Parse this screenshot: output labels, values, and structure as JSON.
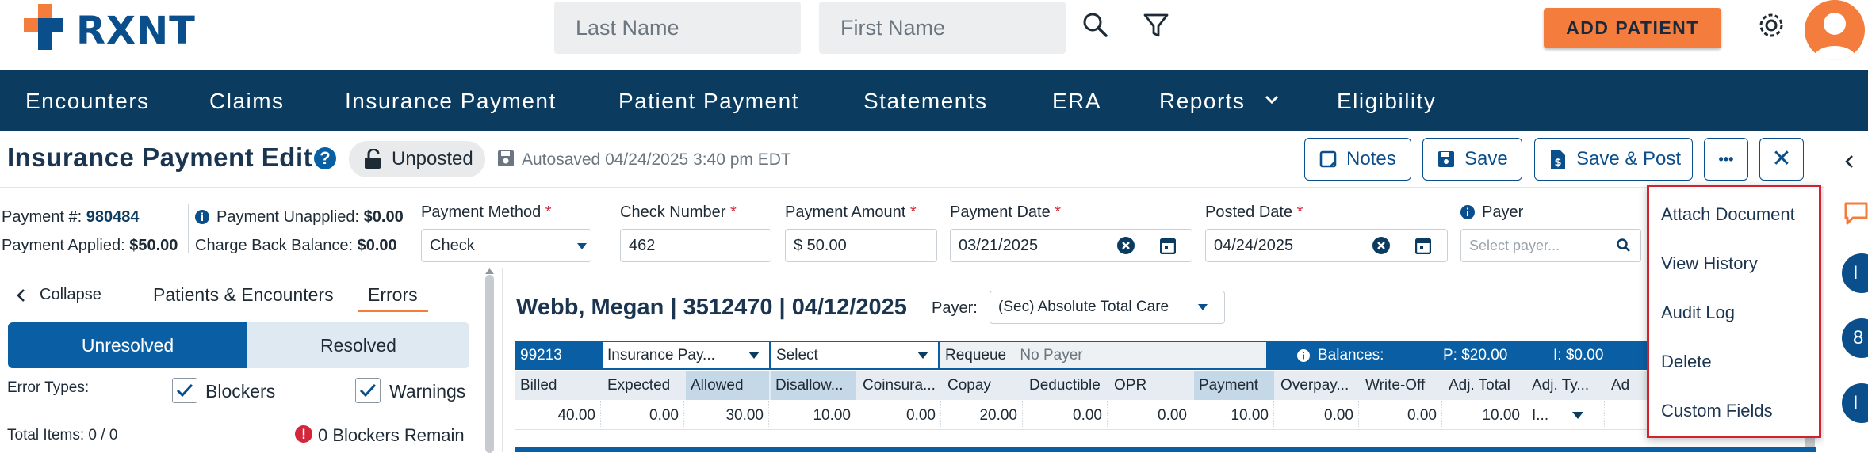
{
  "topbar": {
    "logo_text": "RXNT",
    "last_name_placeholder": "Last Name",
    "first_name_placeholder": "First Name",
    "add_patient_label": "ADD PATIENT",
    "brand_color": "#0a4f8c",
    "accent_color": "#f47c3c"
  },
  "nav": {
    "items": [
      "Encounters",
      "Claims",
      "Insurance Payment",
      "Patient Payment",
      "Statements",
      "ERA",
      "Reports",
      "Eligibility"
    ]
  },
  "header": {
    "title": "Insurance Payment Edit",
    "status": "Unposted",
    "autosaved": "Autosaved 04/24/2025 3:40 pm EDT",
    "notes_label": "Notes",
    "save_label": "Save",
    "save_post_label": "Save & Post",
    "more_label": "•••",
    "close_label": "✕"
  },
  "summary": {
    "payment_no_label": "Payment #:",
    "payment_no": "980484",
    "payment_applied_label": "Payment Applied:",
    "payment_applied": "$50.00",
    "unapplied_label": "Payment Unapplied:",
    "unapplied": "$0.00",
    "chargeback_label": "Charge Back Balance:",
    "chargeback": "$0.00"
  },
  "fields": {
    "payment_method_label": "Payment Method",
    "payment_method": "Check",
    "check_number_label": "Check Number",
    "check_number": "462",
    "payment_amount_label": "Payment Amount",
    "payment_amount": "$ 50.00",
    "payment_date_label": "Payment Date",
    "payment_date": "03/21/2025",
    "posted_date_label": "Posted Date",
    "posted_date": "04/24/2025",
    "payer_label": "Payer",
    "payer_placeholder": "Select payer..."
  },
  "left_panel": {
    "collapse_label": "Collapse",
    "tab_patients": "Patients & Encounters",
    "tab_errors": "Errors",
    "unresolved_label": "Unresolved",
    "resolved_label": "Resolved",
    "error_types_label": "Error Types:",
    "blockers_label": "Blockers",
    "warnings_label": "Warnings",
    "total_items": "Total Items: 0 / 0",
    "blockers_remain": "0 Blockers Remain"
  },
  "encounter": {
    "heading": "Webb, Megan | 3512470 | 04/12/2025",
    "payer_label": "Payer:",
    "payer_value": "(Sec) Absolute Total Care",
    "code": "99213",
    "type_select": "Insurance Pay...",
    "select_label": "Select",
    "requeue_label": "Requeue",
    "no_payer": "No Payer",
    "balances_label": "Balances:",
    "balance_p": "P: $20.00",
    "balance_i": "I: $0.00",
    "columns": [
      "Billed",
      "Expected",
      "Allowed",
      "Disallow...",
      "Coinsura...",
      "Copay",
      "Deductible",
      "OPR",
      "Payment",
      "Overpay...",
      "Write-Off",
      "Adj. Total",
      "Adj. Ty...",
      "Ad"
    ],
    "values": [
      "40.00",
      "0.00",
      "30.00",
      "10.00",
      "0.00",
      "20.00",
      "0.00",
      "0.00",
      "10.00",
      "0.00",
      "0.00",
      "10.00",
      "I...",
      ""
    ]
  },
  "menu": {
    "items": [
      "Attach Document",
      "View History",
      "Audit Log",
      "Delete",
      "Custom Fields"
    ]
  },
  "right_rail": {
    "badges": [
      "I",
      "8",
      "I"
    ]
  }
}
